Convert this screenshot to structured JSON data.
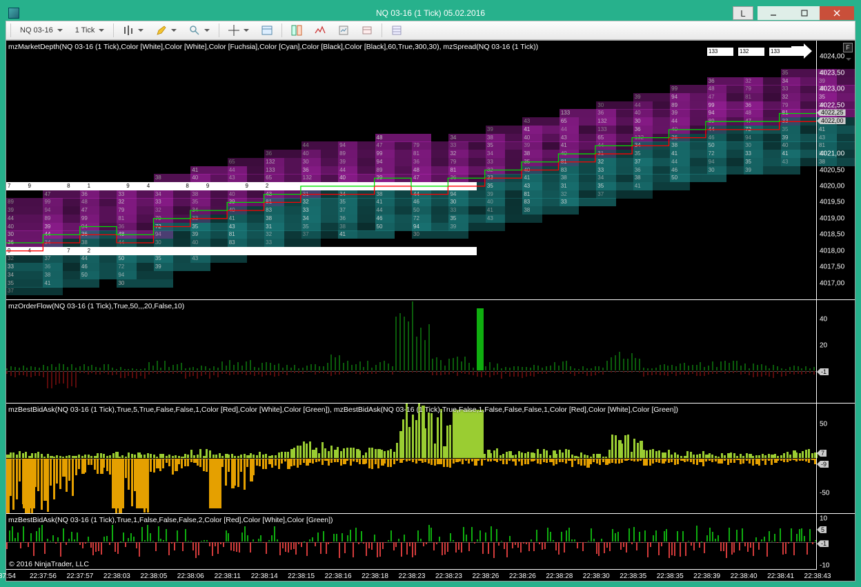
{
  "window": {
    "title": "NQ 03-16 (1 Tick)  05.02.2016",
    "l_button": "L"
  },
  "toolbar": {
    "instrument": "NQ 03-16",
    "interval": "1 Tick"
  },
  "panel1": {
    "label": "mzMarketDepth(NQ 03-16 (1 Tick),Color [White],Color [White],Color [Fuchsia],Color [Cyan],Color [Black],Color [Black],60,True,300,30), mzSpread(NQ 03-16 (1 Tick))",
    "marker_high": "4022,25",
    "marker_low": "4022,00",
    "top_numbers_right": [
      "133",
      "132",
      "133"
    ]
  },
  "panel2": {
    "label": "mzOrderFlow(NQ 03-16 (1 Tick),True,50,,,20,False,10)",
    "marker": "-1"
  },
  "panel3": {
    "label": "mzBestBidAsk(NQ 03-16 (1 Tick),True,5,True,False,False,1,Color [Red],Color [White],Color [Green]), mzBestBidAsk(NQ 03-16 (1 Tick),True,False,1,False,False,False,1,Color [Red],Color [White],Color [Green])",
    "marker_top": "7",
    "marker_bot": "-9"
  },
  "panel4": {
    "label": "mzBestBidAsk(NQ 03-16 (1 Tick),True,1,False,False,False,2,Color [Red],Color [White],Color [Green])",
    "marker_top": "5",
    "marker_bot": "-1"
  },
  "copyright": "© 2016 NinjaTrader, LLC",
  "f_button": "F",
  "chart_data": {
    "type": "candlestick-depth-composite",
    "instrument": "NQ 03-16",
    "interval": "1 Tick",
    "date": "05.02.2016",
    "x_axis_labels": [
      ":37:54",
      "22:37:56",
      "22:37:57",
      "22:38:03",
      "22:38:05",
      "22:38:06",
      "22:38:11",
      "22:38:14",
      "22:38:15",
      "22:38:16",
      "22:38:18",
      "22:38:23",
      "22:38:23",
      "22:38:26",
      "22:38:26",
      "22:38:28",
      "22:38:30",
      "22:38:35",
      "22:38:35",
      "22:38:39",
      "22:38:40",
      "22:38:41",
      "22:38:43"
    ],
    "panels": [
      {
        "name": "MarketDepth+Spread",
        "y_axis": [
          4017.0,
          4017.5,
          4018.0,
          4018.5,
          4019.0,
          4019.5,
          4020.0,
          4020.5,
          4021.0,
          4022.5,
          4023.0,
          4023.5,
          4024.0
        ],
        "ylim": [
          4016.5,
          4024.5
        ],
        "series": [
          {
            "name": "Ask line",
            "color": "#00ff00",
            "values_approx": [
              4018.25,
              4018.5,
              4018.75,
              4018.5,
              4019.0,
              4019.25,
              4019.5,
              4019.75,
              4020.0,
              4020.0,
              4020.25,
              4020.0,
              4020.25,
              4020.5,
              4020.75,
              4021.0,
              4021.25,
              4021.5,
              4021.75,
              4022.0,
              4022.0,
              4022.25,
              4022.25
            ]
          },
          {
            "name": "Bid line",
            "color": "#ff0000",
            "values_approx": [
              4018.0,
              4018.25,
              4018.5,
              4018.25,
              4018.75,
              4019.0,
              4019.25,
              4019.5,
              4019.75,
              4019.75,
              4020.0,
              4019.75,
              4020.0,
              4020.25,
              4020.5,
              4020.75,
              4021.0,
              4021.25,
              4021.5,
              4021.75,
              4021.75,
              4022.0,
              4022.0
            ]
          }
        ],
        "depth_ask_sizes_sample": [
          36,
          30,
          40,
          44,
          39,
          89,
          94,
          99,
          47,
          48,
          36,
          81,
          79,
          32,
          33,
          34,
          35,
          38,
          39,
          40,
          41,
          43,
          44,
          65,
          133,
          132
        ],
        "depth_bid_sizes_sample": [
          31,
          32,
          33,
          34,
          35,
          37,
          36,
          38,
          41,
          44,
          46,
          50,
          72,
          94,
          30,
          33,
          35,
          39,
          40,
          41,
          43,
          81,
          83,
          38
        ],
        "best_bid_size": 94,
        "best_ask_size": 89
      },
      {
        "name": "OrderFlow",
        "y_axis": [
          20,
          40
        ],
        "ylim": [
          -25,
          55
        ],
        "values_up_approx": [
          3,
          5,
          4,
          2,
          6,
          3,
          8,
          5,
          4,
          10,
          6,
          48,
          9,
          5,
          4,
          6,
          3,
          12,
          4,
          5,
          6,
          4,
          3
        ],
        "values_down_approx": [
          4,
          12,
          3,
          6,
          2,
          5,
          3,
          4,
          2,
          3,
          2,
          1,
          3,
          4,
          5,
          2,
          3,
          1,
          4,
          3,
          2,
          4,
          3
        ]
      },
      {
        "name": "BestBidAskHistogram",
        "y_axis": [
          -50,
          50
        ],
        "ylim": [
          -80,
          80
        ],
        "up_values_approx": [
          8,
          5,
          6,
          7,
          5,
          10,
          6,
          8,
          20,
          15,
          12,
          72,
          55,
          12,
          8,
          10,
          6,
          28,
          10,
          8,
          6,
          5,
          10
        ],
        "down_values_approx": [
          78,
          60,
          20,
          72,
          18,
          15,
          35,
          12,
          10,
          8,
          12,
          6,
          10,
          8,
          9,
          8,
          10,
          6,
          8,
          9,
          7,
          8,
          6
        ]
      },
      {
        "name": "BestBidAskTicks",
        "y_axis": [
          -10,
          10
        ],
        "ylim": [
          -12,
          12
        ],
        "values_approx": [
          -3,
          4,
          -2,
          5,
          -4,
          3,
          -2,
          6,
          -3,
          2,
          -8,
          4,
          -2,
          3,
          -5,
          2,
          -3,
          4,
          -2,
          7,
          -3,
          5,
          -2
        ]
      }
    ]
  }
}
